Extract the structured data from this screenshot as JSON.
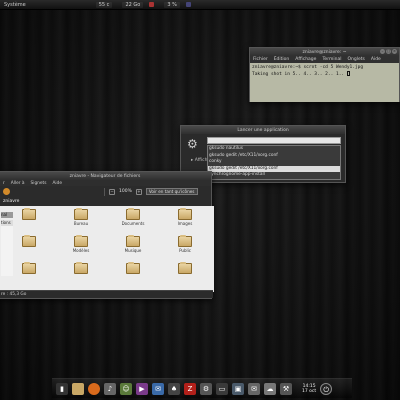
{
  "top_panel": {
    "menu": "Système",
    "indicators": [
      "55 c",
      "22 Go",
      "3 %"
    ]
  },
  "terminal": {
    "title": "zniavre@zniavre: ~",
    "menu": [
      "Fichier",
      "Édition",
      "Affichage",
      "Terminal",
      "Onglets",
      "Aide"
    ],
    "lines": [
      "zniavre@zniavre:~$ scrot -cd 5 Wendy1.jpg",
      "Taking shot in 5.. 4.. 3.. 2.. 1.."
    ]
  },
  "run_app": {
    "title": "Lancer une application",
    "label": "Afficher",
    "input_value": "",
    "options": [
      "gksudo nautilus",
      "gksudo gedit /etc/X11/xorg.conf",
      "conky",
      "gksudo gedit /etc/X11/xorg.conf",
      "synchrognome-app-install"
    ],
    "selected_index": 3
  },
  "file_manager": {
    "title": "zniavre - Navigateur de fichiers",
    "menu": [
      "r",
      "Aller à",
      "Signets",
      "Aide"
    ],
    "zoom": "100%",
    "view_mode": "Voir en tant qu'icônes",
    "path": "zniavre",
    "sidebar_items": [
      "nal",
      "tions"
    ],
    "folders": [
      {
        "label": "",
        "icon": "film-folder"
      },
      {
        "label": "Bureau",
        "icon": "desktop-folder"
      },
      {
        "label": "Documents",
        "icon": "documents-folder"
      },
      {
        "label": "Images",
        "icon": "pictures-folder"
      },
      {
        "label": "",
        "icon": "folder"
      },
      {
        "label": "Modèles",
        "icon": "templates-folder"
      },
      {
        "label": "Musique",
        "icon": "music-folder"
      },
      {
        "label": "Public",
        "icon": "public-folder"
      },
      {
        "label": "",
        "icon": "network-folder"
      },
      {
        "label": "",
        "icon": "folder"
      },
      {
        "label": "",
        "icon": "folder"
      },
      {
        "label": "",
        "icon": "folder"
      }
    ],
    "status": "re : 45,3 Go"
  },
  "dock": {
    "icons": [
      "terminal-icon",
      "folder-icon",
      "firefox-icon",
      "audio-icon",
      "users-icon",
      "media-icon",
      "chat-icon",
      "game-icon",
      "filezilla-icon",
      "settings-icon",
      "display-icon",
      "photos-icon",
      "mail-icon",
      "weather-icon",
      "tools-icon",
      "power-icon"
    ],
    "clock_time": "14:15",
    "clock_date": "17 oct"
  }
}
